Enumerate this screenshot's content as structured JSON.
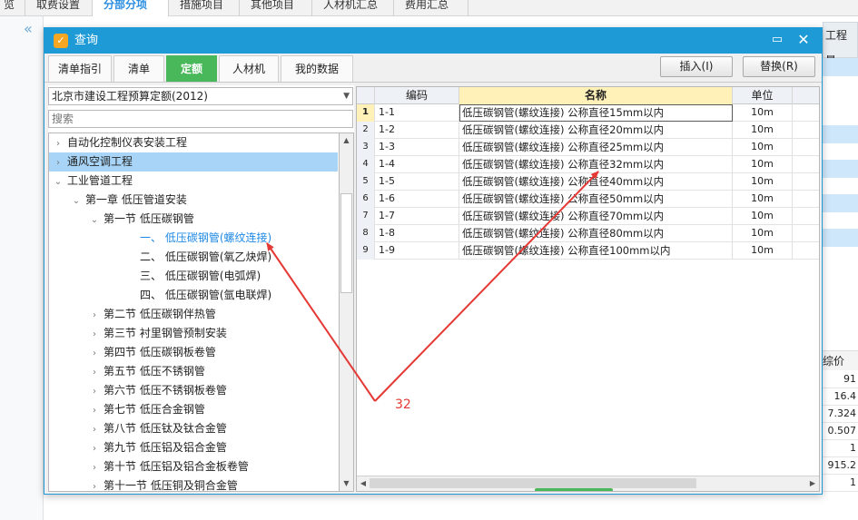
{
  "app_tabs": [
    {
      "label": "览"
    },
    {
      "label": "取费设置"
    },
    {
      "label": "分部分项",
      "active": true
    },
    {
      "label": "措施项目"
    },
    {
      "label": "其他项目"
    },
    {
      "label": "人材机汇总"
    },
    {
      "label": "费用汇总"
    }
  ],
  "background_right": {
    "header": "工程量",
    "price_header": "综价",
    "values": [
      "91",
      "16.4",
      "7.324",
      "0.507",
      "1",
      "915.2",
      "1"
    ]
  },
  "dialog": {
    "title": "查询",
    "tabs": [
      "清单指引",
      "清单",
      "定额",
      "人材机",
      "我的数据"
    ],
    "active_tab": "定额",
    "insert_button": "插入(I)",
    "replace_button": "替换(R)",
    "library": "北京市建设工程预算定额(2012)",
    "search_placeholder": "搜索",
    "tree": [
      {
        "label": "自动化控制仪表安装工程",
        "twist": "›"
      },
      {
        "label": "通风空调工程",
        "twist": "›"
      },
      {
        "label": "工业管道工程",
        "twist": "⌄"
      },
      {
        "label": "第一章  低压管道安装",
        "twist": "⌄"
      },
      {
        "label": "第一节  低压碳钢管",
        "twist": "⌄"
      },
      {
        "label": "一、  低压碳钢管(螺纹连接)",
        "twist": ""
      },
      {
        "label": "二、  低压碳钢管(氧乙炔焊)",
        "twist": ""
      },
      {
        "label": "三、  低压碳钢管(电弧焊)",
        "twist": ""
      },
      {
        "label": "四、  低压碳钢管(氩电联焊)",
        "twist": ""
      },
      {
        "label": "第二节  低压碳钢伴热管",
        "twist": "›"
      },
      {
        "label": "第三节  衬里钢管预制安装",
        "twist": "›"
      },
      {
        "label": "第四节  低压碳钢板卷管",
        "twist": "›"
      },
      {
        "label": "第五节  低压不锈钢管",
        "twist": "›"
      },
      {
        "label": "第六节  低压不锈钢板卷管",
        "twist": "›"
      },
      {
        "label": "第七节  低压合金钢管",
        "twist": "›"
      },
      {
        "label": "第八节  低压钛及钛合金管",
        "twist": "›"
      },
      {
        "label": "第九节  低压铝及铝合金管",
        "twist": "›"
      },
      {
        "label": "第十节  低压铝及铝合金板卷管",
        "twist": "›"
      },
      {
        "label": "第十一节  低压铜及铜合金管",
        "twist": "›"
      }
    ],
    "grid": {
      "headers": {
        "index": "",
        "code": "编码",
        "name": "名称",
        "unit": "单位"
      },
      "rows": [
        {
          "idx": "1",
          "code": "1-1",
          "name": "低压碳钢管(螺纹连接) 公称直径15mm以内",
          "unit": "10m"
        },
        {
          "idx": "2",
          "code": "1-2",
          "name": "低压碳钢管(螺纹连接) 公称直径20mm以内",
          "unit": "10m"
        },
        {
          "idx": "3",
          "code": "1-3",
          "name": "低压碳钢管(螺纹连接) 公称直径25mm以内",
          "unit": "10m"
        },
        {
          "idx": "4",
          "code": "1-4",
          "name": "低压碳钢管(螺纹连接) 公称直径32mm以内",
          "unit": "10m"
        },
        {
          "idx": "5",
          "code": "1-5",
          "name": "低压碳钢管(螺纹连接) 公称直径40mm以内",
          "unit": "10m"
        },
        {
          "idx": "6",
          "code": "1-6",
          "name": "低压碳钢管(螺纹连接) 公称直径50mm以内",
          "unit": "10m"
        },
        {
          "idx": "7",
          "code": "1-7",
          "name": "低压碳钢管(螺纹连接) 公称直径70mm以内",
          "unit": "10m"
        },
        {
          "idx": "8",
          "code": "1-8",
          "name": "低压碳钢管(螺纹连接) 公称直径80mm以内",
          "unit": "10m"
        },
        {
          "idx": "9",
          "code": "1-9",
          "name": "低压碳钢管(螺纹连接) 公称直径100mm以内",
          "unit": "10m"
        }
      ]
    }
  },
  "annotation": {
    "text": "32",
    "color": "#e53935"
  },
  "colors": {
    "title_bar": "#1e9ad6",
    "active_tab": "#49b85a",
    "tree_selection": "#a8d5f7",
    "link": "#1e88e5",
    "name_header": "#fff1b8"
  },
  "icons": [
    "collapse-left-icon",
    "app-logo-icon",
    "maximize-icon",
    "close-icon",
    "dropdown-arrow-icon",
    "expand-icon",
    "collapse-icon"
  ]
}
